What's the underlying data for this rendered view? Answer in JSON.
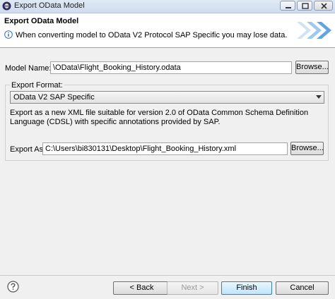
{
  "window": {
    "title": "Export OData Model"
  },
  "header": {
    "title": "Export OData Model",
    "message": "When converting model to OData V2 Protocol SAP Specific you may lose data."
  },
  "model_name": {
    "label": "Model Name:",
    "value": "\\OData\\Flight_Booking_History.odata",
    "browse_label": "Browse..."
  },
  "export_format": {
    "group_label": "Export Format:",
    "selected": "OData V2 SAP Specific",
    "description": "Export as a new XML file suitable for version 2.0 of OData Common Schema Definition Language (CDSL) with specific annotations provided by SAP."
  },
  "export_as": {
    "label": "Export As:",
    "value": "C:\\Users\\bi830131\\Desktop\\Flight_Booking_History.xml",
    "browse_label": "Browse..."
  },
  "footer": {
    "back_label": "< Back",
    "next_label": "Next >",
    "finish_label": "Finish",
    "cancel_label": "Cancel"
  },
  "icons": {
    "app": "eclipse-icon",
    "info": "info-icon",
    "help": "help-icon",
    "banner": "wizard-arrows-icon"
  }
}
